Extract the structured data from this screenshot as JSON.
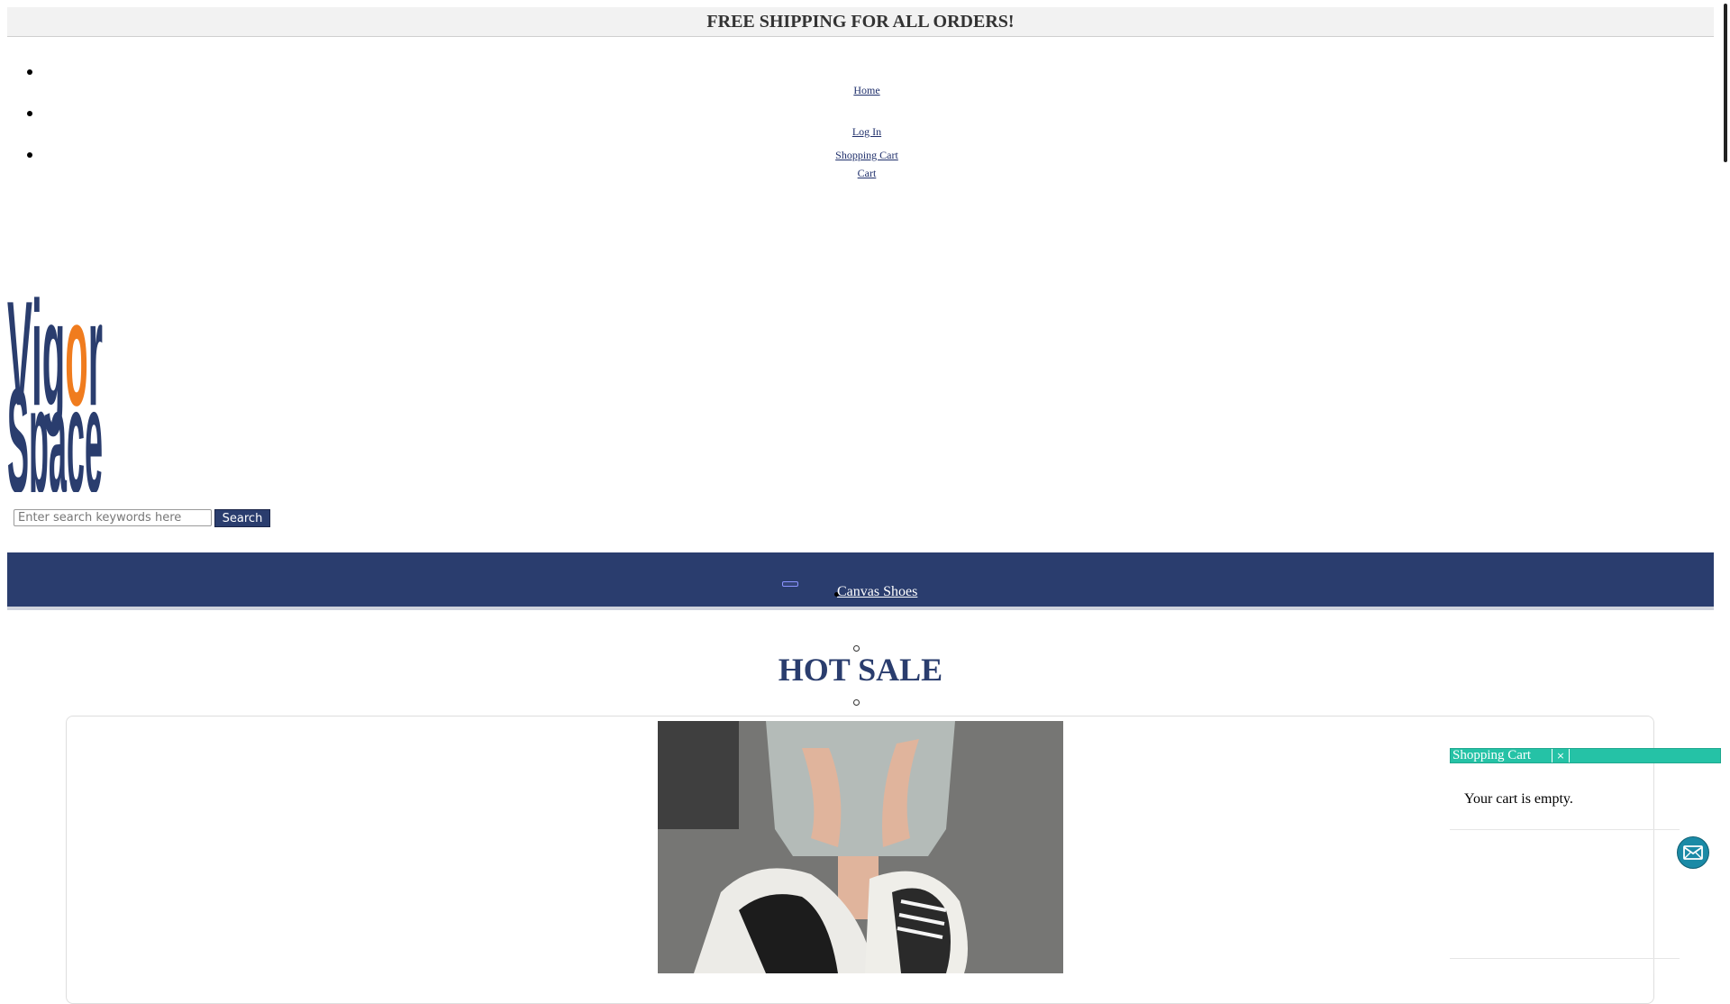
{
  "announcement": "FREE SHIPPING FOR ALL ORDERS!",
  "top_nav": {
    "home": "Home",
    "login": "Log In",
    "shopping_cart": "Shopping Cart",
    "cart": "Cart"
  },
  "logo": {
    "line1": "Vigor",
    "line2": "Space",
    "brand_color": "#2a3d6e",
    "accent_color": "#f07c1e"
  },
  "search": {
    "placeholder": "Enter search keywords here",
    "button_label": "Search"
  },
  "category_nav": {
    "items": [
      "Canvas Shoes"
    ]
  },
  "hot_sale": {
    "title": "HOT SALE"
  },
  "cart_panel": {
    "title": "Shopping Cart",
    "close_symbol": "×",
    "empty_message": "Your cart is empty."
  },
  "colors": {
    "nav_bar": "#2a3d6e",
    "cart_accent": "#25c2a6",
    "chat_button": "#1a8aa6"
  },
  "icons": {
    "chat": "envelope-icon",
    "close": "close-icon"
  }
}
